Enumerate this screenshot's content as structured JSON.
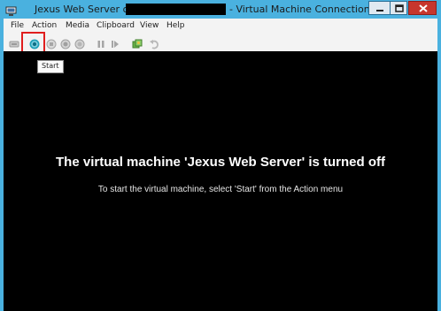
{
  "window": {
    "title_prefix": "Jexus Web Server on",
    "title_suffix": "- Virtual Machine Connection",
    "app_icon": "vm-connection-icon",
    "controls": [
      "minimize-icon",
      "maximize-icon",
      "close-icon"
    ],
    "accent_color": "#4ab1df",
    "close_color": "#c7362d"
  },
  "menu": {
    "file": "File",
    "action": "Action",
    "media": "Media",
    "clipboard": "Clipboard",
    "view": "View",
    "help": "Help"
  },
  "toolbar": {
    "icons": [
      "ctrl-alt-del-icon",
      "start-icon",
      "turn-off-icon",
      "shut-down-icon",
      "save-icon",
      "pause-icon",
      "reset-icon",
      "snapshot-icon",
      "revert-icon"
    ],
    "highlight_color": "#e01e1e"
  },
  "tooltip": {
    "text": "Start"
  },
  "screen": {
    "heading": "The virtual machine 'Jexus Web Server' is turned off",
    "instruction": "To start the virtual machine, select 'Start' from the Action menu",
    "background": "#000000"
  }
}
